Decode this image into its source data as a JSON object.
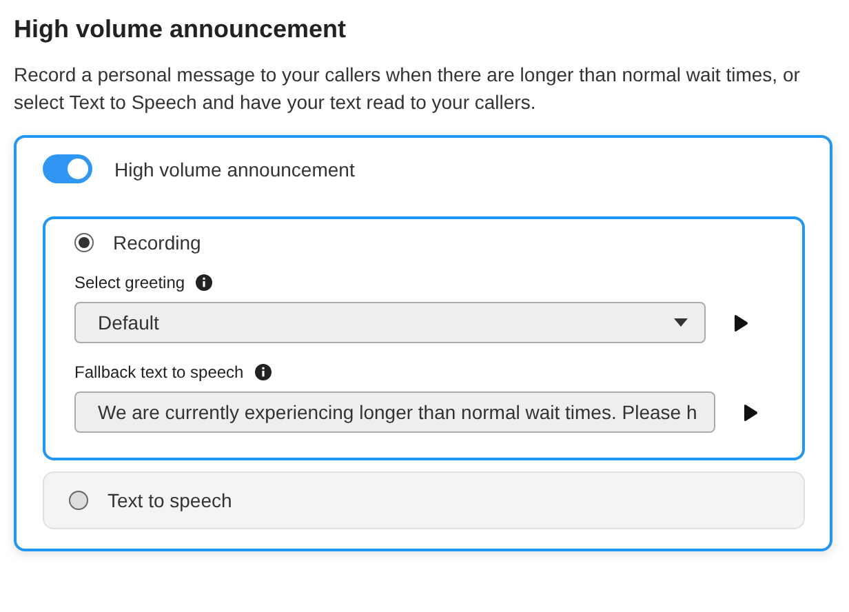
{
  "title": "High volume announcement",
  "description": "Record a personal message to your callers when there are longer than normal wait times, or select Text to Speech and have your text read to your callers.",
  "toggle": {
    "label": "High volume announcement",
    "on": true
  },
  "options": [
    {
      "label": "Recording",
      "selected": true,
      "fields": [
        {
          "kind": "select",
          "label": "Select greeting",
          "value": "Default"
        },
        {
          "kind": "text",
          "label": "Fallback text to speech",
          "value": "We are currently experiencing longer than normal wait times. Please h"
        }
      ]
    },
    {
      "label": "Text to speech",
      "selected": false
    }
  ]
}
